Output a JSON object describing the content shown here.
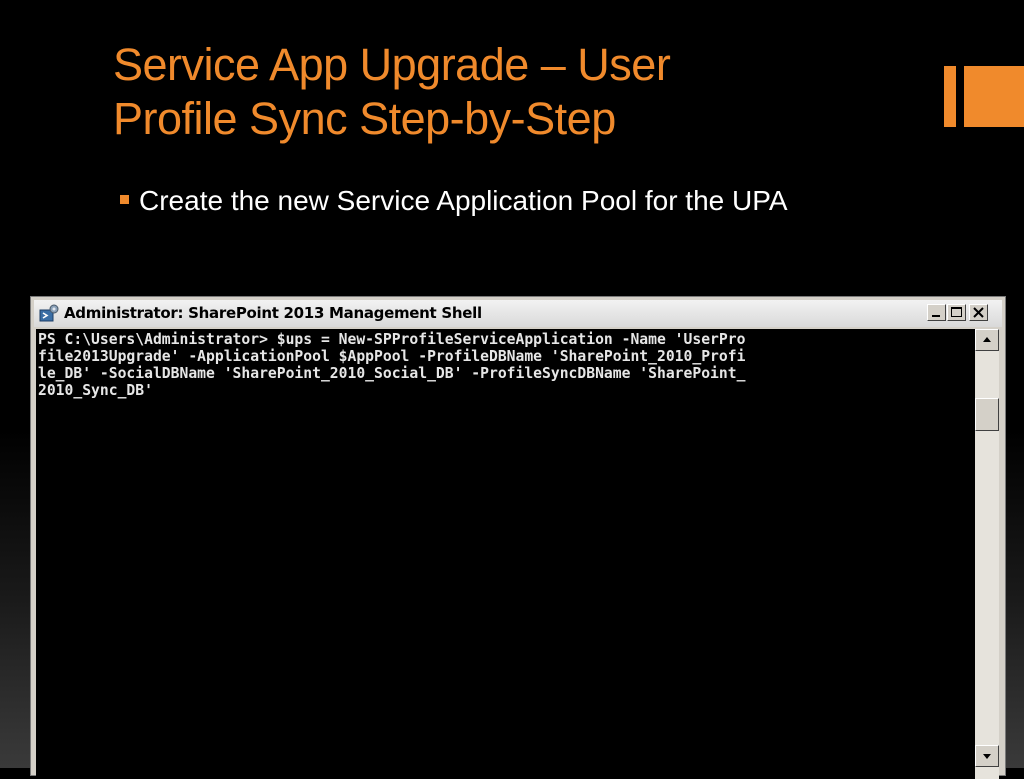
{
  "slide": {
    "title": "Service App Upgrade – User\nProfile Sync Step-by-Step",
    "bullet": "Create the new Service Application Pool for the UPA",
    "accent_color": "#f08a2c"
  },
  "window": {
    "title": "Administrator: SharePoint 2013 Management Shell",
    "icon": "powershell-icon",
    "controls": [
      "minimize-icon",
      "maximize-icon",
      "close-icon"
    ],
    "console_lines": [
      "PS C:\\Users\\Administrator> $ups = New-SPProfileServiceApplication -Name 'UserPro",
      "file2013Upgrade' -ApplicationPool $AppPool -ProfileDBName 'SharePoint_2010_Profi",
      "le_DB' -SocialDBName 'SharePoint_2010_Social_DB' -ProfileSyncDBName 'SharePoint_",
      "2010_Sync_DB'"
    ]
  }
}
